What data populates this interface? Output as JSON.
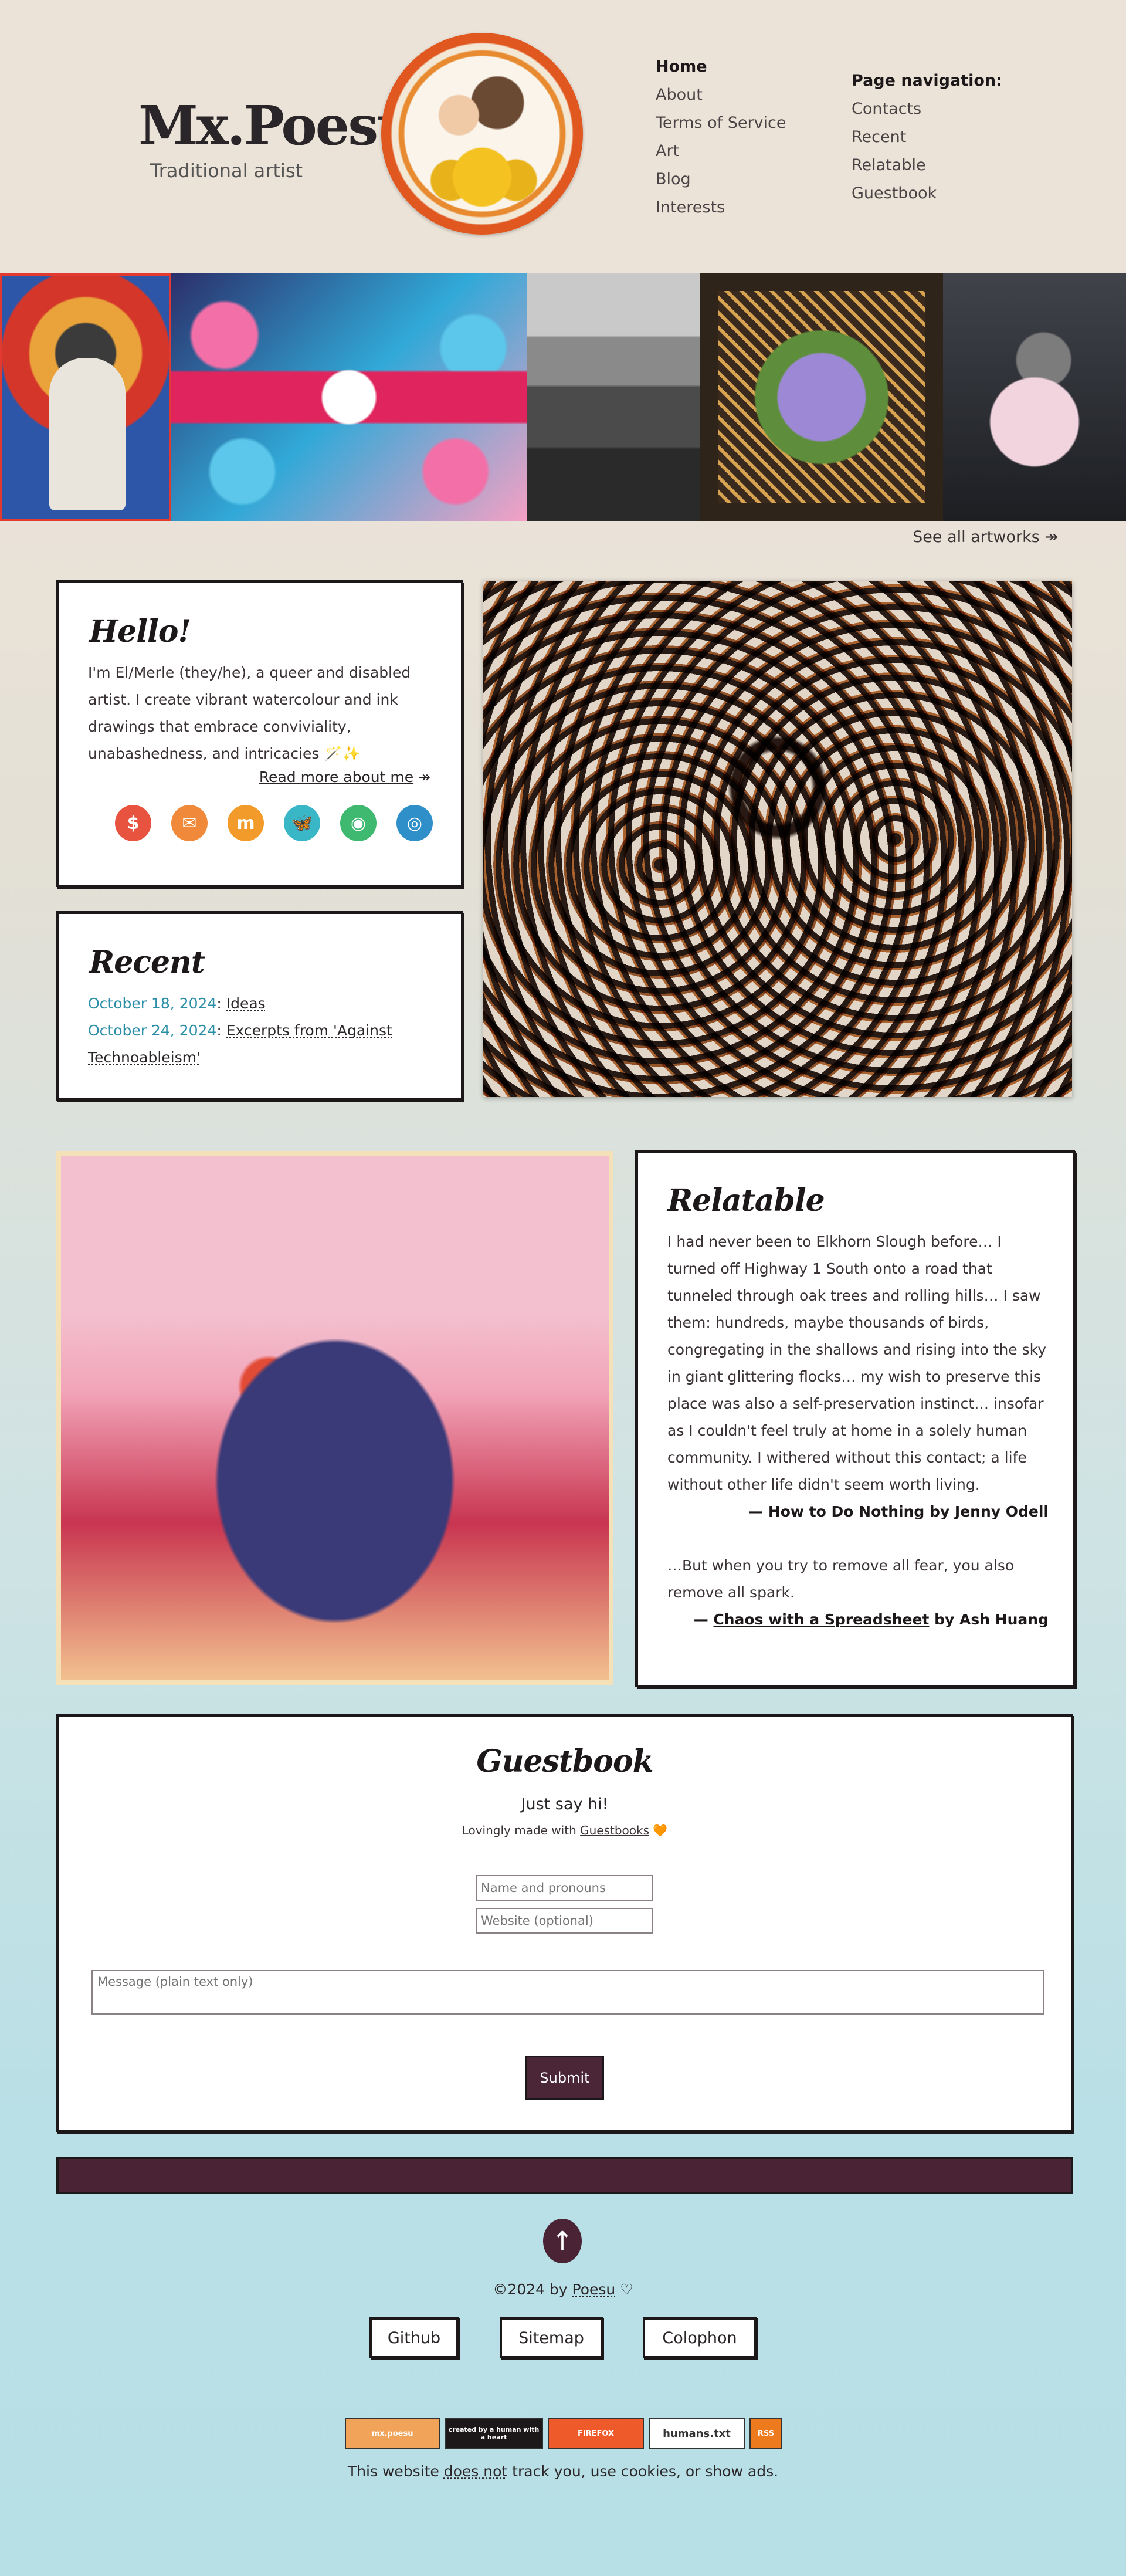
{
  "header": {
    "site_title": "Mx.Poesu",
    "subtitle": "Traditional artist",
    "logo_alt": "Mx. Poesu"
  },
  "main_nav": {
    "items": [
      {
        "label": "Home",
        "current": true
      },
      {
        "label": "About"
      },
      {
        "label": "Terms of Service"
      },
      {
        "label": "Art"
      },
      {
        "label": "Blog"
      },
      {
        "label": "Interests"
      }
    ]
  },
  "page_nav": {
    "heading": "Page navigation:",
    "items": [
      {
        "label": "Contacts"
      },
      {
        "label": "Recent"
      },
      {
        "label": "Relatable"
      },
      {
        "label": "Guestbook"
      }
    ]
  },
  "gallery": {
    "see_all": "See all artworks ↠"
  },
  "hello": {
    "title": "Hello!",
    "text": "I'm El/Merle (they/he), a queer and disabled artist. I create vibrant watercolour and ink drawings that embrace conviviality, unabashedness, and intricacies 🪄✨",
    "read_more": "Read more about me",
    "read_more_arrow": " ↠",
    "social": [
      {
        "icon": "kofi-heart-icon",
        "glyph": "$",
        "color": "#e8533f"
      },
      {
        "icon": "mail-icon",
        "glyph": "✉",
        "color": "#f08a3a"
      },
      {
        "icon": "mastodon-icon",
        "glyph": "m",
        "color": "#f29b2b"
      },
      {
        "icon": "bluesky-icon",
        "glyph": "🦋",
        "color": "#3ab7c6"
      },
      {
        "icon": "pixelfed-icon",
        "glyph": "◉",
        "color": "#3fb870"
      },
      {
        "icon": "sync-icon",
        "glyph": "◎",
        "color": "#2f8fc9"
      }
    ]
  },
  "recent": {
    "title": "Recent",
    "posts": [
      {
        "date": "October 18, 2024",
        "title": "Ideas"
      },
      {
        "date": "October 24, 2024",
        "title": "Excerpts from 'Against Technoableism'"
      }
    ]
  },
  "relatable": {
    "title": "Relatable",
    "quote_1": "I had never been to Elkhorn Slough before… I turned off Highway 1 South onto a road that tunneled through oak trees and rolling hills… I saw them: hundreds, maybe thousands of birds, congregating in the shallows and rising into the sky in giant glittering flocks… my wish to preserve this place was also a self-preservation instinct… insofar as I couldn't feel truly at home in a solely human community. I withered without this contact; a life without other life didn't seem worth living.",
    "cite_1": "— How to Do Nothing by Jenny Odell",
    "quote_2": "…But when you try to remove all fear, you also remove all spark.",
    "cite_2_prefix": "— ",
    "cite_2_link": "Chaos with a Spreadsheet",
    "cite_2_suffix": " by Ash Huang"
  },
  "guestbook": {
    "title": "Guestbook",
    "subtitle": "Just say hi!",
    "made_prefix": "Lovingly made with ",
    "made_link": "Guestbooks",
    "made_heart": " 🧡",
    "name_placeholder": "Name and pronouns",
    "website_placeholder": "Website (optional)",
    "message_placeholder": "Message (plain text only)",
    "submit_label": "Submit"
  },
  "footer": {
    "back_to_top": "↑",
    "copyright_prefix": "©2024 by ",
    "copyright_link": "Poesu",
    "copyright_suffix": " ♡",
    "links": [
      {
        "label": "Github"
      },
      {
        "label": "Sitemap"
      },
      {
        "label": "Colophon"
      }
    ],
    "badges": [
      {
        "label": "mx.poesu",
        "bg": "#f2a35a"
      },
      {
        "label": "created by a human with a heart",
        "bg": "#1c1718"
      },
      {
        "label": "FIREFOX",
        "bg": "#ef5a2a"
      },
      {
        "label": "humans.txt",
        "bg": "#ffffff",
        "fg": "#333"
      },
      {
        "label": "RSS",
        "bg": "#ee7a1e"
      }
    ],
    "privacy_prefix": "This website ",
    "privacy_link": "does not",
    "privacy_suffix": " track you, use cookies, or show ads."
  }
}
